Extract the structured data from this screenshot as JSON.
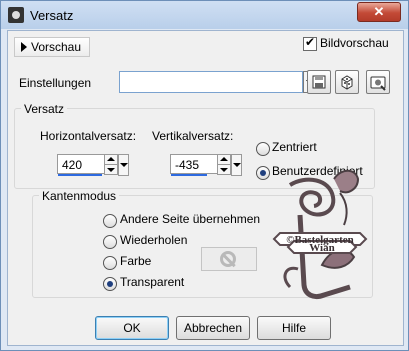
{
  "window": {
    "title": "Versatz",
    "close_symbol": "✕"
  },
  "preview": {
    "toggle_label": "Vorschau",
    "bildvorschau_label": "Bildvorschau",
    "bildvorschau_checked": true
  },
  "settings": {
    "label": "Einstellungen",
    "value": ""
  },
  "versatz": {
    "legend": "Versatz",
    "horizontal": {
      "label": "Horizontalversatz:",
      "value": "420"
    },
    "vertical": {
      "label": "Vertikalversatz:",
      "value": "-435"
    },
    "options": [
      {
        "label": "Zentriert",
        "selected": false
      },
      {
        "label": "Benutzerdefiniert",
        "selected": true
      }
    ]
  },
  "kantenmodus": {
    "legend": "Kantenmodus",
    "options": [
      {
        "label": "Andere Seite übernehmen",
        "selected": false
      },
      {
        "label": "Wiederholen",
        "selected": false
      },
      {
        "label": "Farbe",
        "selected": false
      },
      {
        "label": "Transparent",
        "selected": true
      }
    ]
  },
  "watermark": {
    "line1": "©Bastelgarten",
    "line2": "Wian"
  },
  "buttons": {
    "ok": "OK",
    "cancel": "Abbrechen",
    "help": "Hilfe"
  },
  "icons": [
    "save-icon",
    "dice-icon",
    "preset-manager-icon",
    "disabled-icon"
  ]
}
